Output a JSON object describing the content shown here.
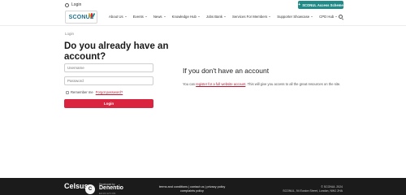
{
  "util": {
    "login_label": "Login",
    "access_button_label": "SCONUL Access Scheme"
  },
  "header": {
    "logo_text": "SCONUL",
    "nav": [
      {
        "label": "About Us"
      },
      {
        "label": "Events"
      },
      {
        "label": "News"
      },
      {
        "label": "Knowledge Hub"
      },
      {
        "label": "Jobs Bank"
      },
      {
        "label": "Services For Members"
      },
      {
        "label": "Supporter Showcase"
      },
      {
        "label": "CPD Hub"
      }
    ]
  },
  "main": {
    "breadcrumb": "Login",
    "title": "Do you already have an account?",
    "username_placeholder": "Username",
    "password_placeholder": "Password",
    "remember_label": "Remember me",
    "forgot_label": "Forgot password?",
    "login_button": "Login"
  },
  "aside": {
    "title": "If you don't have an account",
    "text_before": "You can ",
    "register_link": "register for a full website account",
    "text_after": ". This will give you access to all the great resources on the site."
  },
  "footer": {
    "celsus": "Celsus",
    "developed_by": "Developed by",
    "dev_name": "Denentio",
    "dev_sub": "EDUCATION",
    "links_line1": "terms and conditions | contact us | privacy policy",
    "links_line2": "complaints policy",
    "copyright": "© SCONUL 2024",
    "address": "SCONUL, 94 Euston Street, London, NW1 2HA"
  },
  "colors": {
    "accent_red": "#d9233f",
    "teal": "#1f8a87",
    "footer_bg": "#1b1b1b"
  }
}
